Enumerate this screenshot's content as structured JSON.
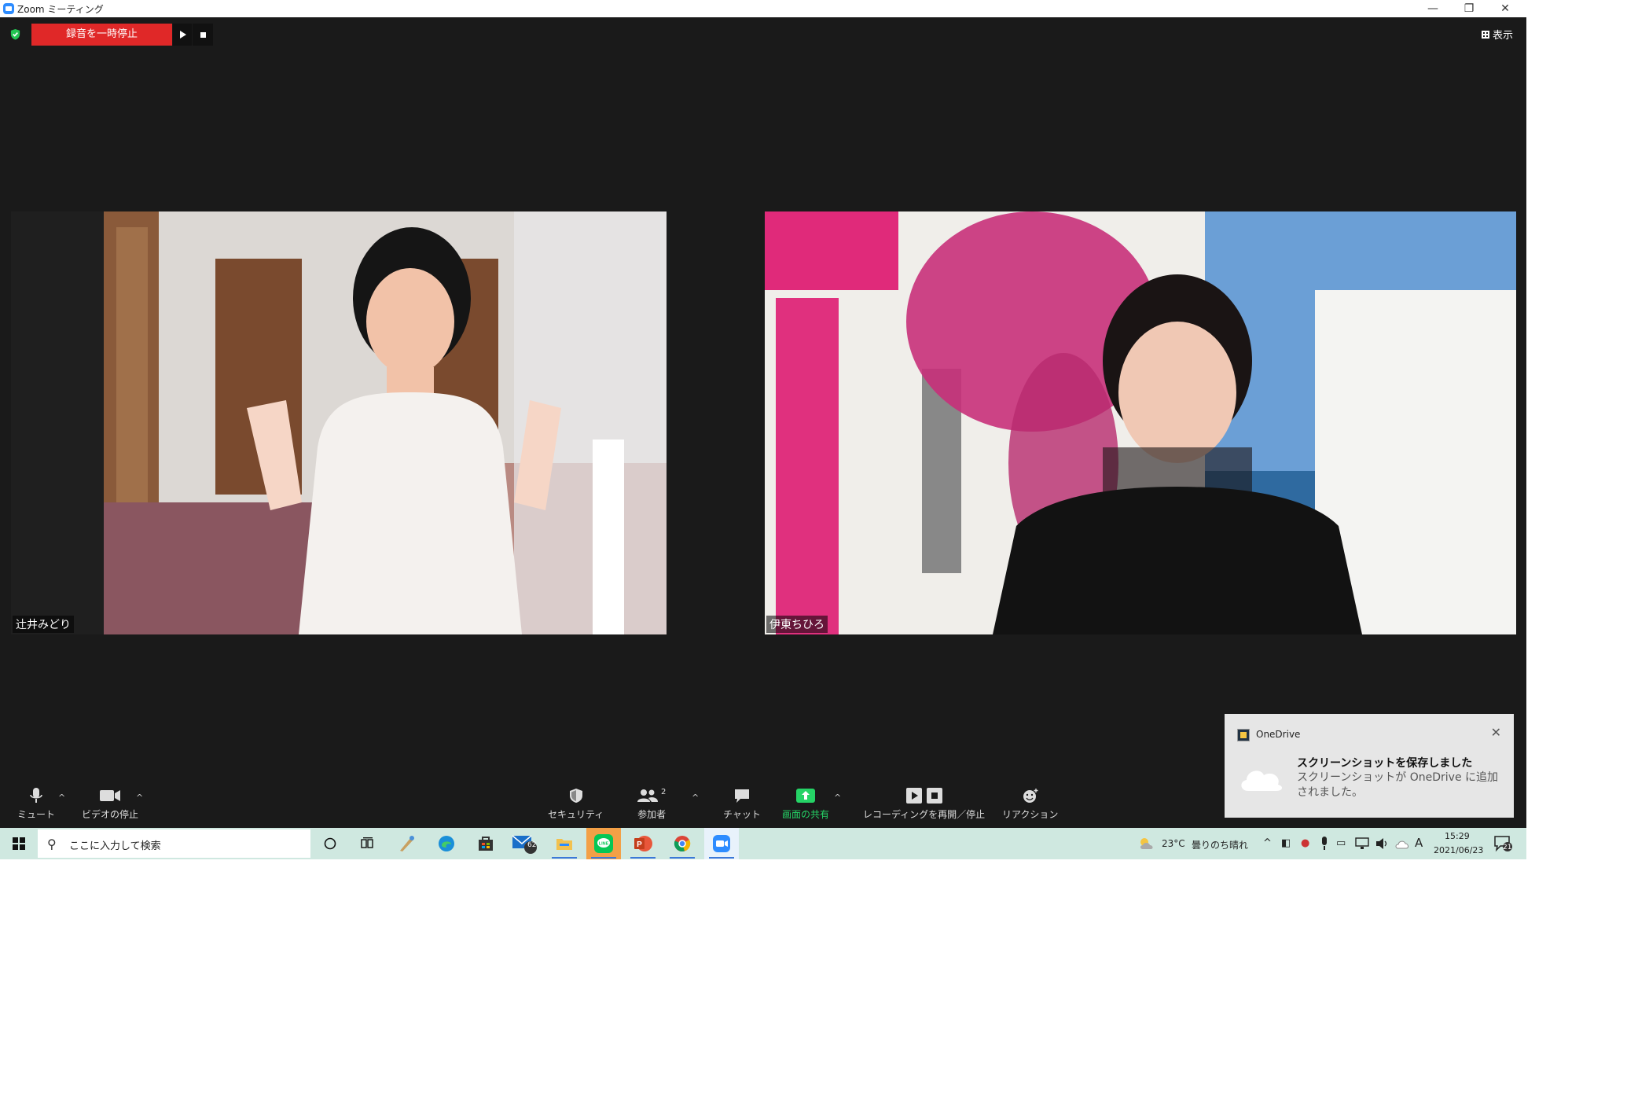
{
  "window": {
    "title": "Zoom ミーティング",
    "controls": {
      "minimize": "—",
      "restore": "❐",
      "close": "✕"
    }
  },
  "recording": {
    "pause_label": "録音を一時停止"
  },
  "view": {
    "label": "表示"
  },
  "participants": [
    {
      "name": "辻井みどり"
    },
    {
      "name": "伊東ちひろ"
    }
  ],
  "toolbar": {
    "mute": "ミュート",
    "stop_video": "ビデオの停止",
    "security": "セキュリティ",
    "participants": "参加者",
    "participants_count": "2",
    "chat": "チャット",
    "share": "画面の共有",
    "recording": "レコーディングを再開／停止",
    "reactions": "リアクション"
  },
  "toast": {
    "app": "OneDrive",
    "title": "スクリーンショットを保存しました",
    "body": "スクリーンショットが OneDrive に追加されました。"
  },
  "taskbar": {
    "search_placeholder": "ここに入力して検索",
    "mail_badge": "62",
    "weather_temp": "23°C",
    "weather_desc": "曇りのち晴れ",
    "ime": "A",
    "time": "15:29",
    "date": "2021/06/23",
    "notifications": "21"
  },
  "colors": {
    "record_red": "#e02828",
    "share_green": "#25d366",
    "taskbar": "#cfe8e0"
  }
}
